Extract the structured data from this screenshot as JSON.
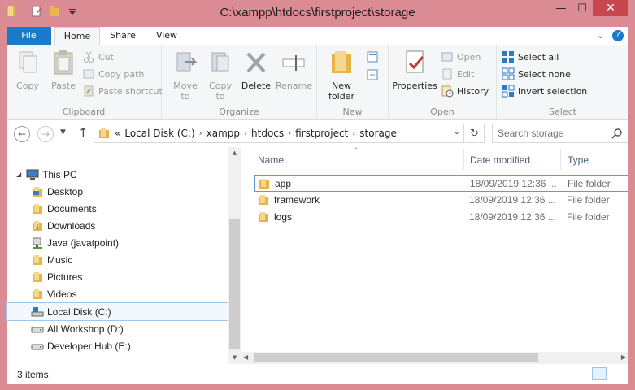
{
  "window": {
    "title": "C:\\xampp\\htdocs\\firstproject\\storage"
  },
  "ribbon_tabs": [
    "File",
    "Home",
    "Share",
    "View"
  ],
  "ribbon": {
    "clipboard": {
      "label": "Clipboard",
      "copy": "Copy",
      "paste": "Paste",
      "cut": "Cut",
      "copy_path": "Copy path",
      "paste_shortcut": "Paste shortcut"
    },
    "organize": {
      "label": "Organize",
      "move_to": "Move\nto",
      "copy_to": "Copy\nto",
      "delete": "Delete",
      "rename": "Rename"
    },
    "new": {
      "label": "New",
      "new_folder": "New\nfolder"
    },
    "open": {
      "label": "Open",
      "properties": "Properties",
      "open": "Open",
      "edit": "Edit",
      "history": "History"
    },
    "select": {
      "label": "Select",
      "select_all": "Select all",
      "select_none": "Select none",
      "invert_selection": "Invert selection"
    }
  },
  "address": {
    "crumbs": [
      "Local Disk (C:)",
      "xampp",
      "htdocs",
      "firstproject",
      "storage"
    ],
    "prefix": "«",
    "search_placeholder": "Search storage"
  },
  "nav": {
    "items": [
      {
        "label": "This PC",
        "icon": "pc-icon"
      },
      {
        "label": "Desktop",
        "icon": "folder-icon"
      },
      {
        "label": "Documents",
        "icon": "folder-icon"
      },
      {
        "label": "Downloads",
        "icon": "folder-icon"
      },
      {
        "label": "Java (javatpoint)",
        "icon": "network-drive-icon"
      },
      {
        "label": "Music",
        "icon": "folder-icon"
      },
      {
        "label": "Pictures",
        "icon": "folder-icon"
      },
      {
        "label": "Videos",
        "icon": "folder-icon"
      },
      {
        "label": "Local Disk (C:)",
        "icon": "drive-icon"
      },
      {
        "label": "All Workshop (D:)",
        "icon": "drive-icon"
      },
      {
        "label": "Developer Hub (E:)",
        "icon": "drive-icon"
      }
    ],
    "selected": "Local Disk (C:)"
  },
  "columns": {
    "name": "Name",
    "date": "Date modified",
    "type": "Type"
  },
  "files": [
    {
      "name": "app",
      "date": "18/09/2019 12:36 ...",
      "type": "File folder"
    },
    {
      "name": "framework",
      "date": "18/09/2019 12:36 ...",
      "type": "File folder"
    },
    {
      "name": "logs",
      "date": "18/09/2019 12:36 ...",
      "type": "File folder"
    }
  ],
  "status": {
    "items_count": "3 items"
  },
  "colors": {
    "file_tab": "#1979ca",
    "title_bar": "#db8b93",
    "selection_border": "#5a9bd8"
  }
}
